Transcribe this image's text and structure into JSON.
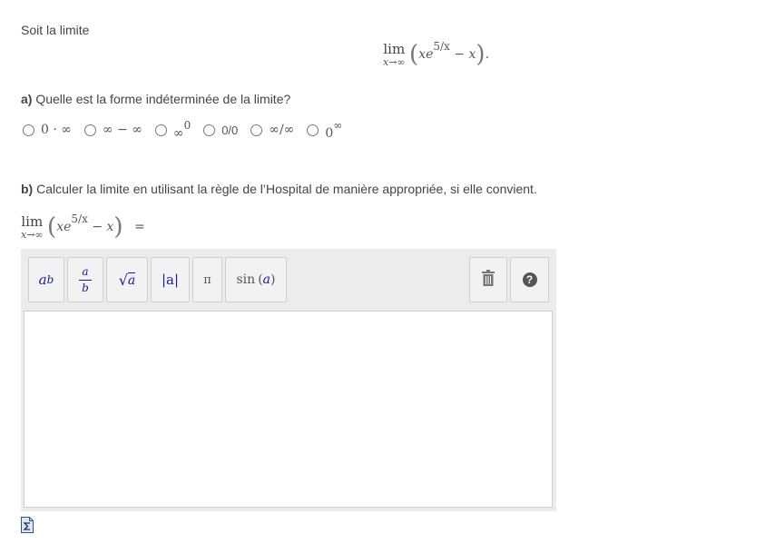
{
  "intro": "Soit la limite",
  "limit_expr": {
    "lim": "lim",
    "sub": "x→∞",
    "x": "x",
    "e": "e",
    "exponent": "5/x",
    "minus": "−",
    "x2": "x",
    "period": "."
  },
  "part_a": {
    "label": "a)",
    "question": "Quelle est la forme indéterminée de la limite?",
    "options": [
      "0 · ∞",
      "∞ − ∞",
      "∞",
      "0/0",
      "∞/∞",
      "0"
    ],
    "option_sups": [
      "",
      "",
      "0",
      "",
      "",
      "∞"
    ]
  },
  "part_b": {
    "label": "b)",
    "question": "Calculer la limite en utilisant la règle de l’Hospital de manière appropriée, si elle convient.",
    "equals": "="
  },
  "toolbar": {
    "power": {
      "base": "a",
      "exp": "b"
    },
    "fraction": {
      "num": "a",
      "den": "b"
    },
    "sqrt": {
      "sign": "√",
      "arg": "a"
    },
    "abs": "|a|",
    "pi": "π",
    "sin": {
      "fn": "sin",
      "arg": "a"
    },
    "trash_icon": "trash-icon",
    "help_label": "?"
  },
  "footer_icon": "sigma-document-icon"
}
